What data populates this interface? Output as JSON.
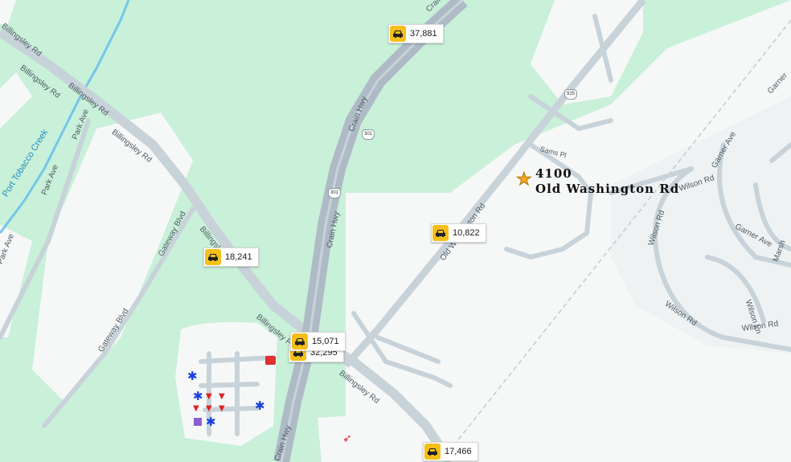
{
  "map": {
    "subject": {
      "number": "4100",
      "street": "Old Washington Rd",
      "marker_icon": "star-icon"
    },
    "traffic_counts": [
      {
        "value": "37,881"
      },
      {
        "value": "10,822"
      },
      {
        "value": "18,241"
      },
      {
        "value": "15,071"
      },
      {
        "value": "32,295"
      },
      {
        "value": "17,466"
      }
    ],
    "road_labels": {
      "billingsley_1": "Billingsley Rd",
      "billingsley_2": "Billingsley Rd",
      "billingsley_3": "Billingsley Rd",
      "billingsley_4": "Billingsley Rd",
      "billingsley_5": "Billingsley R",
      "billingsley_6": "Billingsley Rd",
      "park_ave_1": "Park Ave",
      "park_ave_2": "Park Ave",
      "park_ave_3": "Park Ave",
      "gateway_1": "Gateway Blvd",
      "gateway_2": "Gateway Blvd",
      "crain_1": "Crain Hwy",
      "crain_2": "Crain Hwy",
      "crain_3": "Crain Hwy",
      "old_washington": "Old Washington Rd",
      "sams_pl": "Sams Pl",
      "garner_1": "Garner Ave",
      "garner_2": "Garner Ave",
      "garner_3": "Garner",
      "wilson_1": "Wilson Rd",
      "wilson_2": "Wilson Rd",
      "wilson_3": "Wilson Rd",
      "wilson_4": "Wilson Rd",
      "wilson_ln": "Wilson Ln",
      "marsh": "Marsh"
    },
    "water_labels": {
      "creek": "Port Tobacco Creek"
    },
    "route_shields": {
      "us301_a": "301",
      "us301_b": "301",
      "md925": "925"
    },
    "colors": {
      "land": "#c9f0d8",
      "developed": "#f6f8f8",
      "road": "#c8d2d9",
      "highway": "#aebbc6",
      "water": "#74c6ea",
      "traffic_icon": "#f5bf1a",
      "star": "#f5a623"
    }
  }
}
